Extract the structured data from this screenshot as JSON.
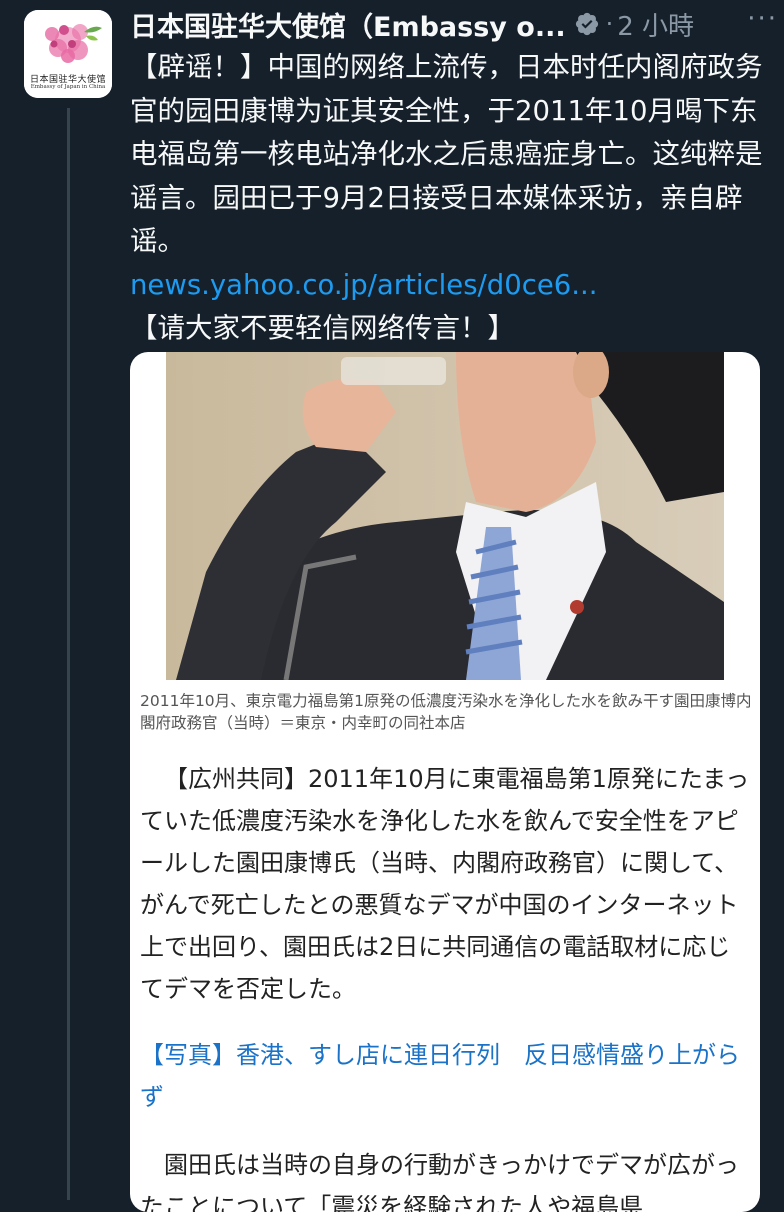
{
  "account": {
    "display_name": "日本国驻华大使馆（Embassy o...",
    "time_sep": "·",
    "time": "2 小時",
    "more": "···",
    "avatar_text_cn": "日本国驻华大使馆",
    "avatar_text_en": "Embassy of Japan in China"
  },
  "tweet": {
    "text": "【辟谣！】中国的网络上流传，日本时任内阁府政务官的园田康博为证其安全性，于2011年10月喝下东电福岛第一核电站净化水之后患癌症身亡。这纯粹是谣言。园田已于9月2日接受日本媒体采访，亲自辟谣。",
    "link": "news.yahoo.co.jp/articles/d0ce6...",
    "closing": "【请大家不要轻信网络传言！】"
  },
  "card": {
    "caption": "2011年10月、東京電力福島第1原発の低濃度汚染水を浄化した水を飲み干す園田康博内閣府政務官（当時）＝東京・内幸町の同社本店",
    "paragraph1": "【広州共同】2011年10月に東電福島第1原発にたまっていた低濃度汚染水を浄化した水を飲んで安全性をアピールした園田康博氏（当時、内閣府政務官）に関して、がんで死亡したとの悪質なデマが中国のインターネット上で出回り、園田氏は2日に共同通信の電話取材に応じてデマを否定した。",
    "related_link": "【写真】香港、すし店に連日行列　反日感情盛り上がらず",
    "paragraph2": "園田氏は当時の自身の行動がきっかけでデマが広がったことについて「震災を経験された人や福島県"
  },
  "colors": {
    "background": "#15202b",
    "link": "#1d9bf0",
    "verified": "#8b98a5",
    "muted_text": "#8b98a5"
  },
  "icons": {
    "verified": "verified-badge-icon",
    "more": "more-options-icon"
  }
}
